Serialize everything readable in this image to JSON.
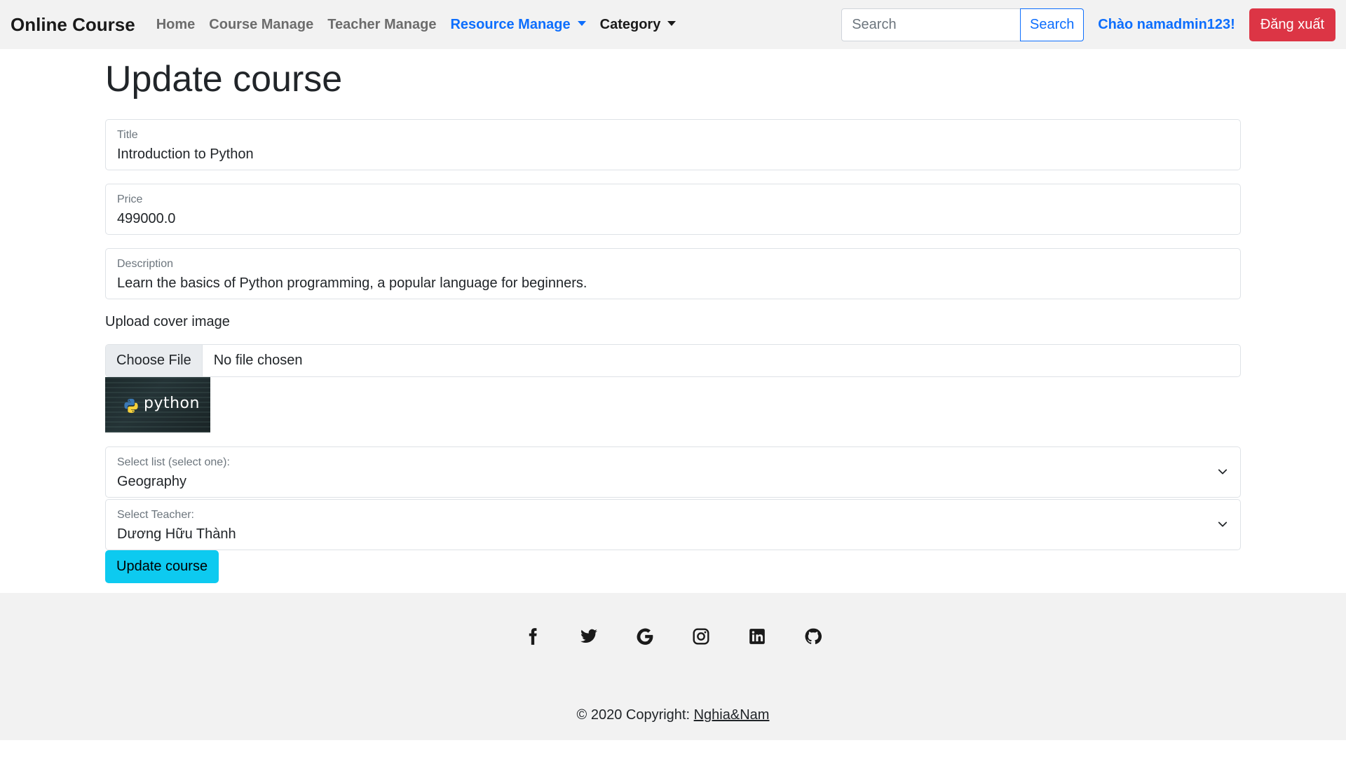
{
  "navbar": {
    "brand": "Online Course",
    "links": [
      {
        "label": "Home"
      },
      {
        "label": "Course Manage"
      },
      {
        "label": "Teacher Manage"
      },
      {
        "label": "Resource Manage"
      },
      {
        "label": "Category"
      }
    ],
    "search_placeholder": "Search",
    "search_button": "Search",
    "greeting": "Chào namadmin123!",
    "logout": "Đăng xuất"
  },
  "page": {
    "title": "Update course"
  },
  "form": {
    "title": {
      "label": "Title",
      "value": "Introduction to Python"
    },
    "price": {
      "label": "Price",
      "value": "499000.0"
    },
    "description": {
      "label": "Description",
      "value": "Learn the basics of Python programming, a popular language for beginners."
    },
    "upload_label": "Upload cover image",
    "file_button": "Choose File",
    "file_status": "No file chosen",
    "cover_text": "python",
    "category_select": {
      "label": "Select list (select one):",
      "value": "Geography"
    },
    "teacher_select": {
      "label": "Select Teacher:",
      "value": "Dương Hữu Thành"
    },
    "submit": "Update course"
  },
  "footer": {
    "socials": [
      "facebook-icon",
      "twitter-icon",
      "google-icon",
      "instagram-icon",
      "linkedin-icon",
      "github-icon"
    ],
    "copyright_prefix": "© 2020 Copyright: ",
    "copyright_link": "Nghia&Nam"
  },
  "colors": {
    "primary": "#0d6efd",
    "danger": "#dc3545",
    "info": "#0dcaf0",
    "navbar_bg": "#f2f2f2"
  }
}
